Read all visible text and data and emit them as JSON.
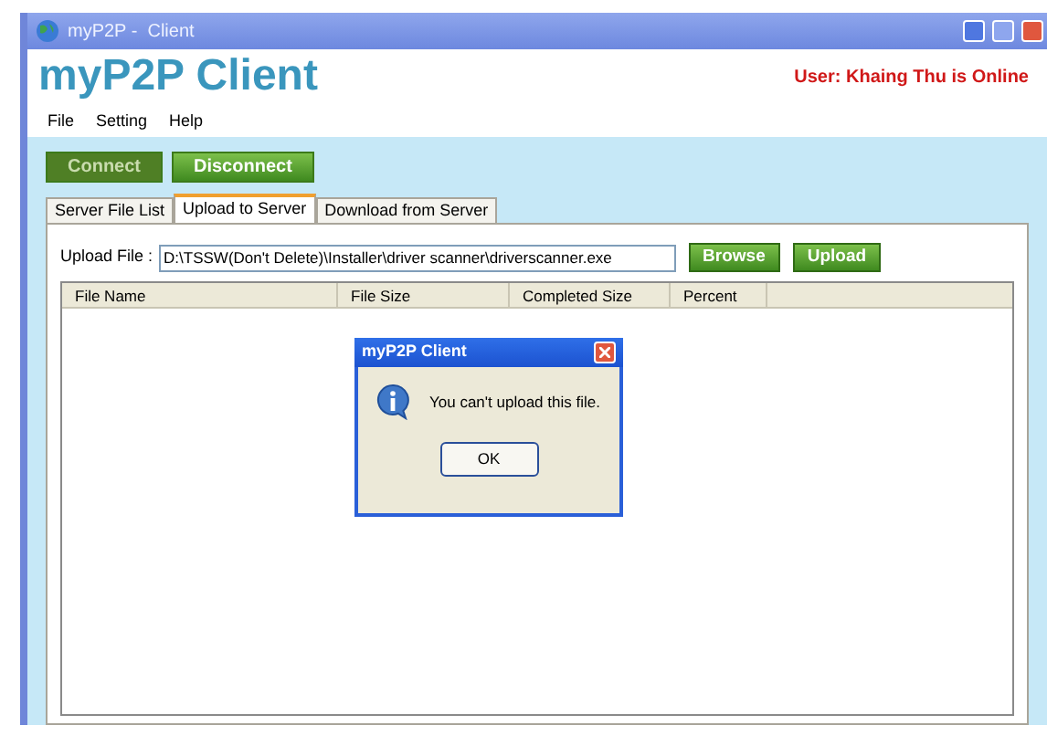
{
  "window": {
    "title": "myP2P -  Client"
  },
  "header": {
    "app_name": "myP2P Client",
    "user_status": "User: Khaing Thu is Online"
  },
  "menu": [
    "File",
    "Setting",
    "Help"
  ],
  "buttons": [
    {
      "label": "Connect",
      "disabled": true
    },
    {
      "label": "Disconnect",
      "disabled": false
    }
  ],
  "tabs": [
    {
      "label": "Server File List",
      "selected": false
    },
    {
      "label": "Upload to Server",
      "selected": true
    },
    {
      "label": "Download from Server",
      "selected": false
    }
  ],
  "upload": {
    "label": "Upload File :",
    "value": "D:\\TSSW(Don't Delete)\\Installer\\driver scanner\\driverscanner.exe",
    "buttons": [
      "Browse",
      "Upload"
    ]
  },
  "table": {
    "columns": [
      "File Name",
      "File Size",
      "Completed Size",
      "Percent"
    ]
  },
  "dialog": {
    "title": "myP2P Client",
    "message": "You can't upload this file.",
    "button": "OK"
  }
}
